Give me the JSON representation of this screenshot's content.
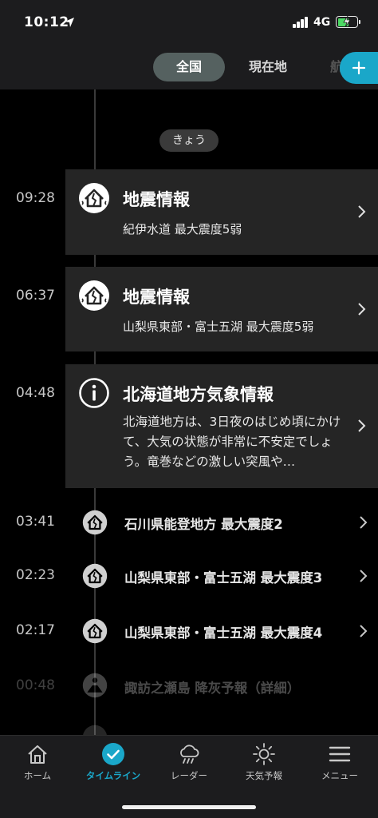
{
  "status_bar": {
    "time": "10:12",
    "network": "4G",
    "battery_color": "#4cd964"
  },
  "tabs": [
    {
      "label": "全国",
      "active": true
    },
    {
      "label": "現在地",
      "active": false
    },
    {
      "label": "航",
      "active": false
    }
  ],
  "add_button": {
    "icon": "plus-icon",
    "color": "#1aa7c9"
  },
  "timeline": {
    "day_label": "きょう",
    "cards": [
      {
        "time": "09:28",
        "icon": "earthquake-house-icon",
        "title": "地震情報",
        "subtitle": "紀伊水道 最大震度5弱"
      },
      {
        "time": "06:37",
        "icon": "earthquake-house-icon",
        "title": "地震情報",
        "subtitle": "山梨県東部・富士五湖 最大震度5弱"
      },
      {
        "time": "04:48",
        "icon": "info-icon",
        "title": "北海道地方気象情報",
        "body": "北海道地方は、3日夜のはじめ頃にかけて、大気の状態が非常に不安定でしょう。竜巻などの激しい突風や…"
      }
    ],
    "rows": [
      {
        "time": "03:41",
        "icon": "earthquake-house-icon",
        "text": "石川県能登地方 最大震度2"
      },
      {
        "time": "02:23",
        "icon": "earthquake-house-icon",
        "text": "山梨県東部・富士五湖 最大震度3"
      },
      {
        "time": "02:17",
        "icon": "earthquake-house-icon",
        "text": "山梨県東部・富士五湖 最大震度4"
      },
      {
        "time": "00:48",
        "icon": "volcano-icon",
        "text": "諏訪之瀬島 降灰予報（詳細）"
      }
    ]
  },
  "bottom_nav": [
    {
      "label": "ホーム",
      "icon": "home-icon",
      "active": false
    },
    {
      "label": "タイムライン",
      "icon": "check-circle-icon",
      "active": true
    },
    {
      "label": "レーダー",
      "icon": "rain-cloud-icon",
      "active": false
    },
    {
      "label": "天気予報",
      "icon": "sun-icon",
      "active": false
    },
    {
      "label": "メニュー",
      "icon": "menu-icon",
      "active": false
    }
  ],
  "accent_color": "#1aa7c9"
}
